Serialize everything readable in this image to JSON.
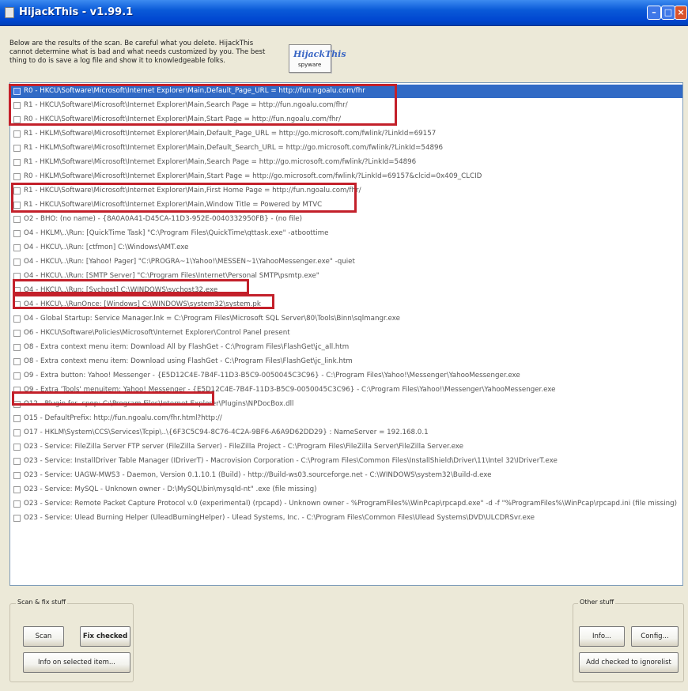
{
  "window": {
    "title": "HijackThis - v1.99.1"
  },
  "intro": {
    "text": "Below are the results of the scan. Be careful what you delete. HijackThis cannot determine what is bad and what needs customized by you. The best thing to do is save a log file and show it to knowledgeable folks."
  },
  "logo": {
    "top": "HijackThis",
    "bottom": "spyware"
  },
  "results": [
    {
      "text": "R0 - HKCU\\Software\\Microsoft\\Internet Explorer\\Main,Default_Page_URL = http://fun.ngoalu.com/fhr",
      "selected": true
    },
    {
      "text": "R1 - HKCU\\Software\\Microsoft\\Internet Explorer\\Main,Search Page = http://fun.ngoalu.com/fhr/",
      "selected": false
    },
    {
      "text": "R0 - HKCU\\Software\\Microsoft\\Internet Explorer\\Main,Start Page = http://fun.ngoalu.com/fhr/",
      "selected": false
    },
    {
      "text": "R1 - HKLM\\Software\\Microsoft\\Internet Explorer\\Main,Default_Page_URL = http://go.microsoft.com/fwlink/?LinkId=69157",
      "selected": false
    },
    {
      "text": "R1 - HKLM\\Software\\Microsoft\\Internet Explorer\\Main,Default_Search_URL = http://go.microsoft.com/fwlink/?LinkId=54896",
      "selected": false
    },
    {
      "text": "R1 - HKLM\\Software\\Microsoft\\Internet Explorer\\Main,Search Page = http://go.microsoft.com/fwlink/?LinkId=54896",
      "selected": false
    },
    {
      "text": "R0 - HKLM\\Software\\Microsoft\\Internet Explorer\\Main,Start Page = http://go.microsoft.com/fwlink/?LinkId=69157&clcid=0x409_CLCID",
      "selected": false
    },
    {
      "text": "R1 - HKCU\\Software\\Microsoft\\Internet Explorer\\Main,First Home Page = http://fun.ngoalu.com/fhr/",
      "selected": false
    },
    {
      "text": "R1 - HKCU\\Software\\Microsoft\\Internet Explorer\\Main,Window Title = Powered by MTVC",
      "selected": false
    },
    {
      "text": "O2 - BHO: (no name) - {8A0A0A41-D45CA-11D3-952E-0040332950FB} - (no file)",
      "selected": false
    },
    {
      "text": "O4 - HKLM\\..\\Run: [QuickTime Task] \"C:\\Program Files\\QuickTime\\qttask.exe\" -atboottime",
      "selected": false
    },
    {
      "text": "O4 - HKCU\\..\\Run: [ctfmon] C:\\Windows\\AMT.exe",
      "selected": false
    },
    {
      "text": "O4 - HKCU\\..\\Run: [Yahoo! Pager] \"C:\\PROGRA~1\\Yahoo!\\MESSEN~1\\YahooMessenger.exe\" -quiet",
      "selected": false
    },
    {
      "text": "O4 - HKCU\\..\\Run: [SMTP Server] \"C:\\Program Files\\Internet\\Personal SMTP\\psmtp.exe\"",
      "selected": false
    },
    {
      "text": "O4 - HKCU\\..\\Run: [Svchost] C:\\WINDOWS\\svchost32.exe",
      "selected": false
    },
    {
      "text": "O4 - HKCU\\..\\RunOnce: [Windows] C:\\WINDOWS\\system32\\system.pk",
      "selected": false
    },
    {
      "text": "O4 - Global Startup: Service Manager.lnk = C:\\Program Files\\Microsoft SQL Server\\80\\Tools\\Binn\\sqlmangr.exe",
      "selected": false
    },
    {
      "text": "O6 - HKCU\\Software\\Policies\\Microsoft\\Internet Explorer\\Control Panel present",
      "selected": false
    },
    {
      "text": "O8 - Extra context menu item: Download All by FlashGet - C:\\Program Files\\FlashGet\\jc_all.htm",
      "selected": false
    },
    {
      "text": "O8 - Extra context menu item: Download using FlashGet - C:\\Program Files\\FlashGet\\jc_link.htm",
      "selected": false
    },
    {
      "text": "O9 - Extra button: Yahoo! Messenger - {E5D12C4E-7B4F-11D3-B5C9-0050045C3C96} - C:\\Program Files\\Yahoo!\\Messenger\\YahooMessenger.exe",
      "selected": false
    },
    {
      "text": "O9 - Extra 'Tools' menuitem: Yahoo! Messenger - {E5D12C4E-7B4F-11D3-B5C9-0050045C3C96} - C:\\Program Files\\Yahoo!\\Messenger\\YahooMessenger.exe",
      "selected": false
    },
    {
      "text": "O12 - Plugin for .spop: C:\\Program Files\\Internet Explorer\\Plugins\\NPDocBox.dll",
      "selected": false
    },
    {
      "text": "O15 - DefaultPrefix: http://fun.ngoalu.com/fhr.html?http://",
      "selected": false
    },
    {
      "text": "O17 - HKLM\\System\\CCS\\Services\\Tcpip\\..\\{6F3C5C94-8C76-4C2A-9BF6-A6A9D62DD29} : NameServer = 192.168.0.1",
      "selected": false
    },
    {
      "text": "O23 - Service: FileZilla Server FTP server (FileZilla Server) - FileZilla Project - C:\\Program Files\\FileZilla Server\\FileZilla Server.exe",
      "selected": false
    },
    {
      "text": "O23 - Service: InstallDriver Table Manager (IDriverT) - Macrovision Corporation - C:\\Program Files\\Common Files\\InstallShield\\Driver\\11\\Intel 32\\IDriverT.exe",
      "selected": false
    },
    {
      "text": "O23 - Service: UAGW-MWS3 - Daemon, Version 0.1.10.1 (Build) - http://Build-ws03.sourceforge.net - C:\\WINDOWS\\system32\\Build-d.exe",
      "selected": false
    },
    {
      "text": "O23 - Service: MySQL - Unknown owner - D:\\MySQL\\bin\\mysqld-nt\" .exe (file missing)",
      "selected": false
    },
    {
      "text": "O23 - Service: Remote Packet Capture Protocol v.0 (experimental) (rpcapd) - Unknown owner - %ProgramFiles%\\WinPcap\\rpcapd.exe\" -d -f \"%ProgramFiles%\\WinPcap\\rpcapd.ini (file missing)",
      "selected": false
    },
    {
      "text": "O23 - Service: Ulead Burning Helper (UleadBurningHelper) - Ulead Systems, Inc. - C:\\Program Files\\Common Files\\Ulead Systems\\DVD\\ULCDRSvr.exe",
      "selected": false
    }
  ],
  "left_group": {
    "title": "Scan & fix stuff",
    "scan_label": "Scan",
    "fix_checked_label": "Fix checked",
    "info_selected_label": "Info on selected item..."
  },
  "right_group": {
    "title": "Other stuff",
    "info_label": "Info...",
    "config_label": "Config...",
    "add_ignorelist_label": "Add checked to ignorelist"
  }
}
